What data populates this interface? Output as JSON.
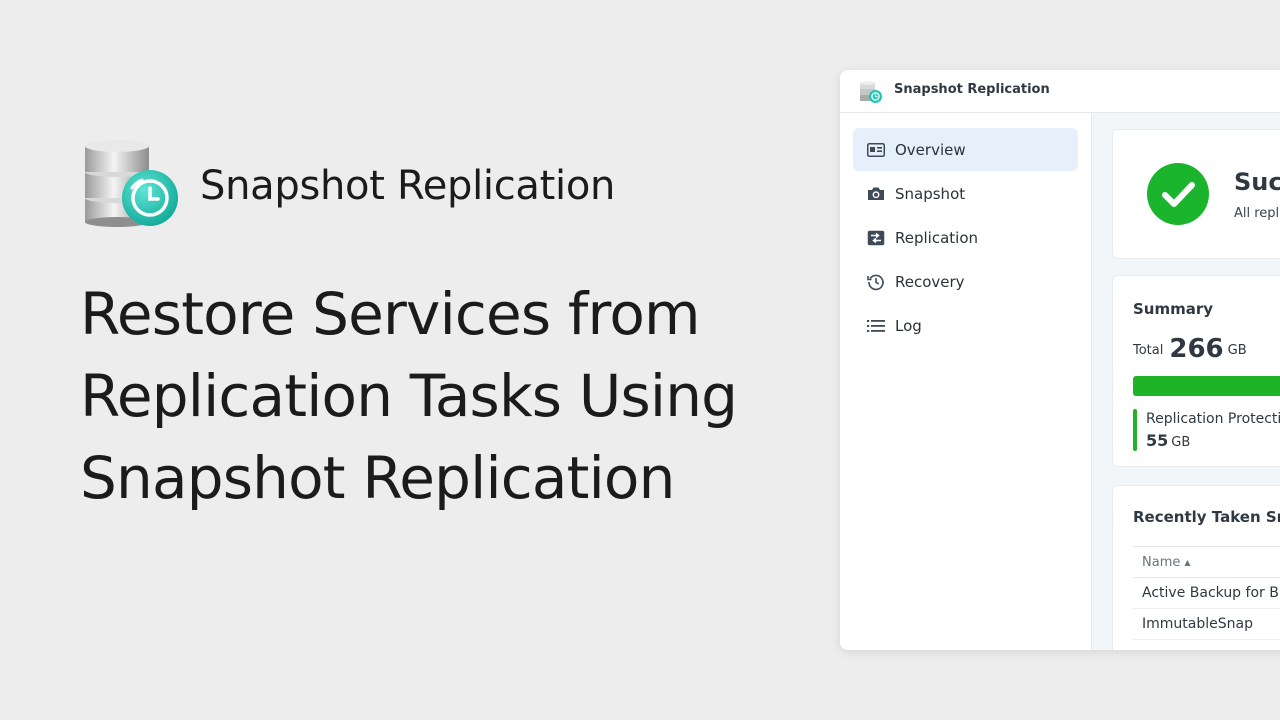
{
  "hero": {
    "app_name": "Snapshot Replication",
    "headline_lines": [
      "Restore Services from",
      "Replication Tasks Using",
      "Snapshot Replication"
    ]
  },
  "window": {
    "title": "Snapshot Replication",
    "sidebar": {
      "items": [
        {
          "label": "Overview",
          "icon": "overview-icon",
          "active": true
        },
        {
          "label": "Snapshot",
          "icon": "camera-icon",
          "active": false
        },
        {
          "label": "Replication",
          "icon": "replication-icon",
          "active": false
        },
        {
          "label": "Recovery",
          "icon": "history-icon",
          "active": false
        },
        {
          "label": "Log",
          "icon": "list-icon",
          "active": false
        }
      ]
    },
    "status": {
      "title": "Suc",
      "subtitle": "All repl",
      "icon": "check-circle-icon"
    },
    "summary": {
      "title": "Summary",
      "total_label": "Total",
      "total_value": "266",
      "total_unit": "GB",
      "bar_fill_fraction": 1.0,
      "legend_label": "Replication Protectio",
      "legend_value": "55",
      "legend_unit": "GB"
    },
    "recent": {
      "title": "Recently Taken Sn",
      "column_name": "Name",
      "rows": [
        "Active Backup for Bu",
        "ImmutableSnap",
        "......"
      ]
    }
  },
  "colors": {
    "page_bg": "#ededed",
    "accent_blue": "#e6f0fb",
    "success_green": "#1fb427",
    "check_green": "#1bb52d",
    "logo_teal": "#1cc7b6"
  }
}
